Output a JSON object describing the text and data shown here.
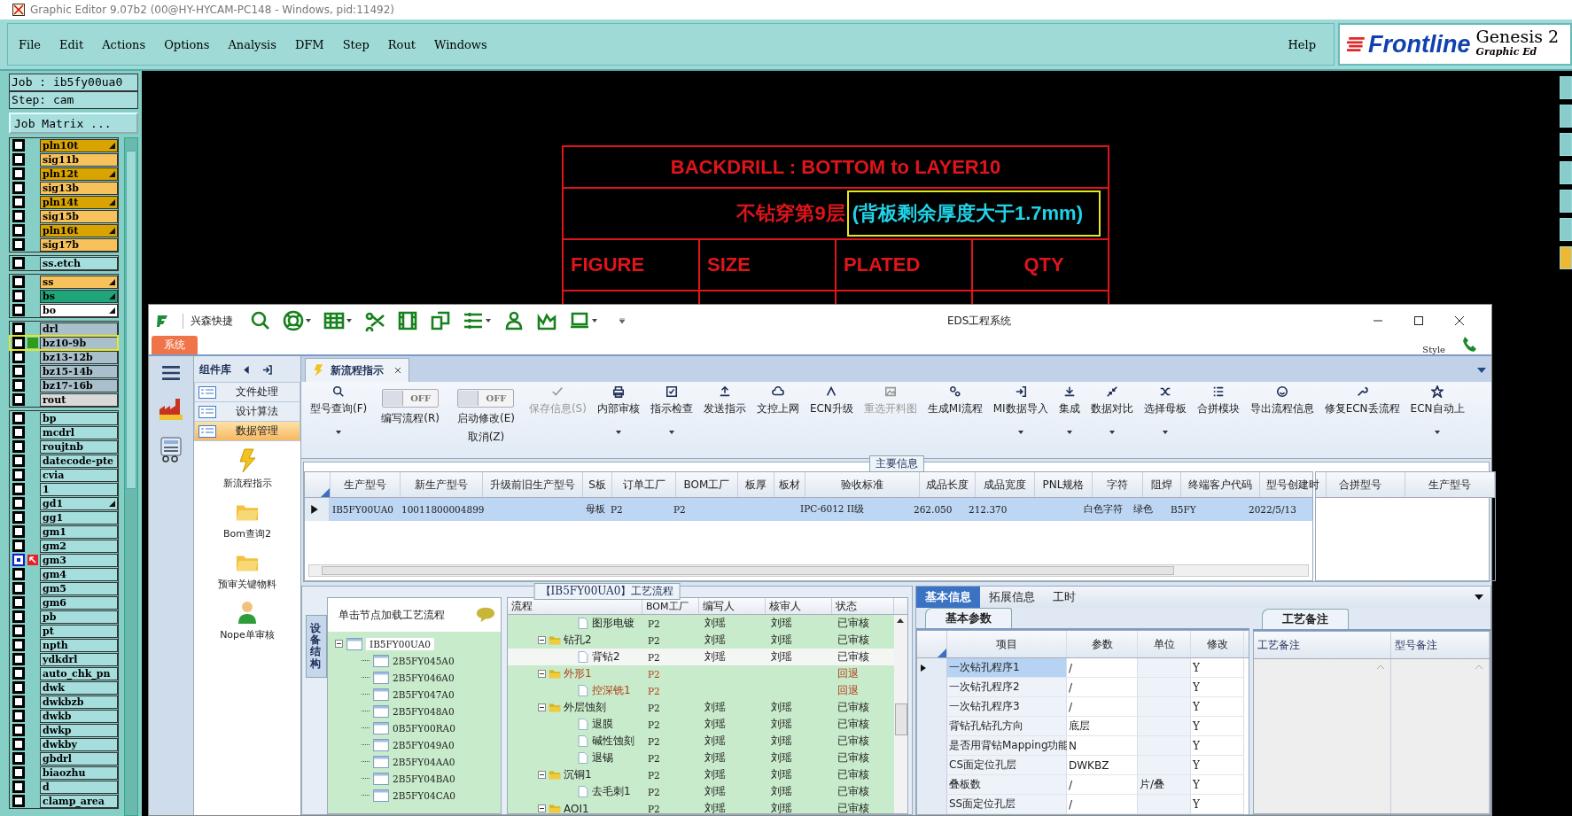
{
  "app_title": "Graphic Editor 9.07b2 (00@HY-HYCAM-PC148 - Windows, pid:11492)",
  "menu": [
    "File",
    "Edit",
    "Actions",
    "Options",
    "Analysis",
    "DFM",
    "Step",
    "Rout",
    "Windows"
  ],
  "help": "Help",
  "brand": {
    "name": "Frontline",
    "product": "Genesis 2",
    "subtitle": "Graphic Ed"
  },
  "job": {
    "job_line": "Job : ib5fy00ua0",
    "step_line": "Step: cam",
    "matrix_button": "Job Matrix ..."
  },
  "layer_groups": [
    {
      "layers": [
        {
          "name": "pln10t",
          "color": "#d9a300",
          "marked": true,
          "checked": false,
          "selected": false
        },
        {
          "name": "sig11b",
          "color": "#f7c25c",
          "marked": false,
          "checked": false,
          "selected": false
        },
        {
          "name": "pln12t",
          "color": "#d9a300",
          "marked": true,
          "checked": false,
          "selected": false
        },
        {
          "name": "sig13b",
          "color": "#f7c25c",
          "marked": false,
          "checked": false,
          "selected": false
        },
        {
          "name": "pln14t",
          "color": "#d9a300",
          "marked": true,
          "checked": false,
          "selected": false
        },
        {
          "name": "sig15b",
          "color": "#f7c25c",
          "marked": false,
          "checked": false,
          "selected": false
        },
        {
          "name": "pln16t",
          "color": "#d9a300",
          "marked": true,
          "checked": false,
          "selected": false
        },
        {
          "name": "sig17b",
          "color": "#f7c25c",
          "marked": false,
          "checked": false,
          "selected": false
        }
      ]
    },
    {
      "layers": [
        {
          "name": "ss.etch",
          "color": "#a6dede",
          "marked": false,
          "checked": false,
          "selected": false
        }
      ]
    },
    {
      "layers": [
        {
          "name": "ss",
          "color": "#f7c25c",
          "marked": true,
          "checked": false,
          "selected": false
        },
        {
          "name": "bs",
          "color": "#1fa57a",
          "marked": true,
          "checked": false,
          "selected": false
        },
        {
          "name": "bo",
          "color": "#ffffff",
          "marked": true,
          "checked": false,
          "selected": false
        }
      ]
    },
    {
      "layers": [
        {
          "name": "drl",
          "color": "#a9c0cc",
          "marked": false,
          "checked": false,
          "selected": false
        },
        {
          "name": "bz10-9b",
          "color": "#a9c0cc",
          "marked": false,
          "checked": false,
          "selected": true
        },
        {
          "name": "bz13-12b",
          "color": "#a9c0cc",
          "marked": false,
          "checked": false,
          "selected": false
        },
        {
          "name": "bz15-14b",
          "color": "#a9c0cc",
          "marked": false,
          "checked": false,
          "selected": false
        },
        {
          "name": "bz17-16b",
          "color": "#a9c0cc",
          "marked": false,
          "checked": false,
          "selected": false
        },
        {
          "name": "rout",
          "color": "#d9d9d9",
          "marked": false,
          "checked": false,
          "selected": false
        }
      ]
    },
    {
      "layers": [
        {
          "name": "bp",
          "color": "#a6dede",
          "marked": false,
          "checked": false,
          "selected": false
        },
        {
          "name": "mcdrl",
          "color": "#a6dede",
          "marked": false,
          "checked": false,
          "selected": false
        },
        {
          "name": "roujtnb",
          "color": "#a6dede",
          "marked": false,
          "checked": false,
          "selected": false
        },
        {
          "name": "datecode-pte",
          "color": "#a6dede",
          "marked": false,
          "checked": false,
          "selected": false
        },
        {
          "name": "cvia",
          "color": "#a6dede",
          "marked": false,
          "checked": false,
          "selected": false
        },
        {
          "name": "1",
          "color": "#a6dede",
          "marked": false,
          "checked": false,
          "selected": false
        },
        {
          "name": "gd1",
          "color": "#a6dede",
          "marked": true,
          "checked": false,
          "selected": false
        },
        {
          "name": "gg1",
          "color": "#a6dede",
          "marked": false,
          "checked": false,
          "selected": false
        },
        {
          "name": "gm1",
          "color": "#a6dede",
          "marked": false,
          "checked": false,
          "selected": false
        },
        {
          "name": "gm2",
          "color": "#a6dede",
          "marked": false,
          "checked": false,
          "selected": false
        },
        {
          "name": "gm3",
          "color": "#a6dede",
          "marked": false,
          "checked": true,
          "selected": false
        },
        {
          "name": "gm4",
          "color": "#a6dede",
          "marked": false,
          "checked": false,
          "selected": false
        },
        {
          "name": "gm5",
          "color": "#a6dede",
          "marked": false,
          "checked": false,
          "selected": false
        },
        {
          "name": "gm6",
          "color": "#a6dede",
          "marked": false,
          "checked": false,
          "selected": false
        },
        {
          "name": "pb",
          "color": "#a6dede",
          "marked": false,
          "checked": false,
          "selected": false
        },
        {
          "name": "pt",
          "color": "#a6dede",
          "marked": false,
          "checked": false,
          "selected": false
        },
        {
          "name": "npth",
          "color": "#a6dede",
          "marked": false,
          "checked": false,
          "selected": false
        },
        {
          "name": "ydkdrl",
          "color": "#a6dede",
          "marked": false,
          "checked": false,
          "selected": false
        },
        {
          "name": "auto_chk_pn",
          "color": "#a6dede",
          "marked": false,
          "checked": false,
          "selected": false
        },
        {
          "name": "dwk",
          "color": "#a6dede",
          "marked": false,
          "checked": false,
          "selected": false
        },
        {
          "name": "dwkbzb",
          "color": "#a6dede",
          "marked": false,
          "checked": false,
          "selected": false
        },
        {
          "name": "dwkb",
          "color": "#a6dede",
          "marked": false,
          "checked": false,
          "selected": false
        },
        {
          "name": "dwkp",
          "color": "#a6dede",
          "marked": false,
          "checked": false,
          "selected": false
        },
        {
          "name": "dwkby",
          "color": "#a6dede",
          "marked": false,
          "checked": false,
          "selected": false
        },
        {
          "name": "gbdrl",
          "color": "#a6dede",
          "marked": false,
          "checked": false,
          "selected": false
        },
        {
          "name": "biaozhu",
          "color": "#a6dede",
          "marked": false,
          "checked": false,
          "selected": false
        },
        {
          "name": "d",
          "color": "#a6dede",
          "marked": false,
          "checked": false,
          "selected": false
        },
        {
          "name": "clamp_area",
          "color": "#a6dede",
          "marked": false,
          "checked": false,
          "selected": false
        }
      ]
    }
  ],
  "canvas": {
    "title": "BACKDRILL : BOTTOM to LAYER10",
    "note": "不钻穿第9层",
    "note_highlight": "(背板剩余厚度大于1.7mm)",
    "headers": [
      "FIGURE",
      "SIZE",
      "PLATED",
      "QTY"
    ]
  },
  "eds": {
    "brand": "兴森快捷",
    "title": "EDS工程系统",
    "system_tab": "系统",
    "style": "Style",
    "toolbar": [
      {
        "has_menu": false
      },
      {
        "has_menu": true
      },
      {
        "has_menu": true
      },
      {
        "has_menu": false
      },
      {
        "has_menu": false
      },
      {
        "has_menu": false
      },
      {
        "has_menu": true
      },
      {
        "has_menu": false
      },
      {
        "has_menu": false
      },
      {
        "has_menu": true
      }
    ],
    "panel_title": "组件库",
    "panel_items": [
      {
        "label": "文件处理",
        "selected": false
      },
      {
        "label": "设计算法",
        "selected": false
      },
      {
        "label": "数据管理",
        "selected": true
      }
    ],
    "shortcuts": [
      {
        "label": "新流程指示"
      },
      {
        "label": "Bom查询2"
      },
      {
        "label": "预审关键物料"
      },
      {
        "label": "Nope单审核"
      }
    ],
    "doc_tab": "新流程指示",
    "ribbon": [
      {
        "kind": "button",
        "label": "型号查询(F)",
        "has_menu": true,
        "disabled": false
      },
      {
        "kind": "toggle",
        "label": "编写流程(R)",
        "switch_text": "OFF",
        "on": false
      },
      {
        "kind": "toggle",
        "label": "启动修改(E)",
        "label2": "取消(Z)",
        "switch_text": "OFF",
        "on": false
      },
      {
        "kind": "button",
        "label": "保存信息(S)",
        "has_menu": false,
        "disabled": true
      },
      {
        "kind": "button",
        "label": "内部审核",
        "has_menu": true,
        "disabled": false
      },
      {
        "kind": "button",
        "label": "指示检查",
        "has_menu": true,
        "disabled": false
      },
      {
        "kind": "button",
        "label": "发送指示",
        "has_menu": false,
        "disabled": false
      },
      {
        "kind": "button",
        "label": "文控上网",
        "has_menu": false,
        "disabled": false
      },
      {
        "kind": "button",
        "label": "ECN升级",
        "has_menu": false,
        "disabled": false
      },
      {
        "kind": "button",
        "label": "重选开料图",
        "has_menu": false,
        "disabled": true
      },
      {
        "kind": "button",
        "label": "生成MI流程",
        "has_menu": false,
        "disabled": false
      },
      {
        "kind": "button",
        "label": "MI数据导入",
        "has_menu": true,
        "disabled": false
      },
      {
        "kind": "button",
        "label": "集成",
        "has_menu": true,
        "disabled": false
      },
      {
        "kind": "button",
        "label": "数据对比",
        "has_menu": true,
        "disabled": false
      },
      {
        "kind": "button",
        "label": "选择母板",
        "has_menu": true,
        "disabled": false
      },
      {
        "kind": "button",
        "label": "合拼模块",
        "has_menu": false,
        "disabled": false
      },
      {
        "kind": "button",
        "label": "导出流程信息",
        "has_menu": false,
        "disabled": false
      },
      {
        "kind": "button",
        "label": "修复ECN丢流程",
        "has_menu": false,
        "disabled": false
      },
      {
        "kind": "button",
        "label": "ECN自动上",
        "has_menu": true,
        "disabled": false
      }
    ],
    "main_info": {
      "title": "主要信息",
      "columns": [
        "生产型号",
        "新生产型号",
        "升级前旧生产型号",
        "S板",
        "订单工厂",
        "BOM工厂",
        "板厚",
        "板材",
        "验收标准",
        "成品长度",
        "成品宽度",
        "PNL规格",
        "字符",
        "阻焊",
        "终端客户代码",
        "型号创建时"
      ],
      "rows": [
        {
          "selected": true,
          "cells": [
            "IB5FY00UA0",
            "10011800004899",
            null,
            "母板",
            "P2",
            "P2",
            null,
            null,
            "IPC-6012 II级",
            "262.050",
            "212.370",
            null,
            "白色字符",
            "绿色",
            "B5FY",
            "2022/5/13"
          ]
        }
      ],
      "side_columns": [
        "合拼型号",
        "生产型号"
      ]
    },
    "process": {
      "title": "【IB5FY00UA0】工艺流程",
      "side_tab": "设备结构",
      "tree_hint": "单击节点加载工艺流程",
      "tree": [
        {
          "label": "IB5FY00UA0",
          "expanded": true,
          "children": [
            {
              "label": "2B5FY045A0"
            },
            {
              "label": "2B5FY046A0"
            },
            {
              "label": "2B5FY047A0"
            },
            {
              "label": "2B5FY048A0"
            },
            {
              "label": "0B5FY00RA0"
            },
            {
              "label": "2B5FY049A0"
            },
            {
              "label": "2B5FY04AA0"
            },
            {
              "label": "2B5FY04BA0"
            },
            {
              "label": "2B5FY04CA0"
            }
          ]
        }
      ],
      "columns": [
        "流程",
        "BOM工厂",
        "编写人",
        "核审人",
        "状态"
      ],
      "rows": [
        {
          "kind": "group",
          "children": [
            {
              "kind": "file",
              "name": "图形电镀",
              "bom": "P2",
              "writer": "刘瑶",
              "reviewer": "刘瑶",
              "status": "已审核",
              "returned": false,
              "selected": false
            }
          ]
        },
        {
          "kind": "folder",
          "name": "钻孔2",
          "bom": "P2",
          "writer": "刘瑶",
          "reviewer": "刘瑶",
          "status": "已审核",
          "returned": false,
          "selected": false,
          "expanded": true,
          "children": [
            {
              "kind": "file",
              "name": "背钻2",
              "bom": "P2",
              "writer": "刘瑶",
              "reviewer": "刘瑶",
              "status": "已审核",
              "returned": false,
              "selected": true
            }
          ]
        },
        {
          "kind": "folder",
          "name": "外形1",
          "bom": "P2",
          "status": "回退",
          "returned": true,
          "selected": false,
          "expanded": true,
          "children": [
            {
              "kind": "file",
              "name": "控深铣1",
              "bom": "P2",
              "status": "回退",
              "returned": true,
              "selected": false
            }
          ]
        },
        {
          "kind": "folder",
          "name": "外层蚀刻",
          "bom": "P2",
          "writer": "刘瑶",
          "reviewer": "刘瑶",
          "status": "已审核",
          "returned": false,
          "selected": false,
          "expanded": true,
          "children": [
            {
              "kind": "file",
              "name": "退膜",
              "bom": "P2",
              "writer": "刘瑶",
              "reviewer": "刘瑶",
              "status": "已审核",
              "returned": false,
              "selected": false
            },
            {
              "kind": "file",
              "name": "碱性蚀刻",
              "bom": "P2",
              "writer": "刘瑶",
              "reviewer": "刘瑶",
              "status": "已审核",
              "returned": false,
              "selected": false
            },
            {
              "kind": "file",
              "name": "退锡",
              "bom": "P2",
              "writer": "刘瑶",
              "reviewer": "刘瑶",
              "status": "已审核",
              "returned": false,
              "selected": false
            }
          ]
        },
        {
          "kind": "folder",
          "name": "沉铜1",
          "bom": "P2",
          "writer": "刘瑶",
          "reviewer": "刘瑶",
          "status": "已审核",
          "returned": false,
          "selected": false,
          "expanded": true,
          "children": [
            {
              "kind": "file",
              "name": "去毛刺1",
              "bom": "P2",
              "writer": "刘瑶",
              "reviewer": "刘瑶",
              "status": "已审核",
              "returned": false,
              "selected": false
            }
          ]
        },
        {
          "kind": "folder",
          "name": "AOI1",
          "bom": "P2",
          "writer": "刘瑶",
          "reviewer": "刘瑶",
          "status": "已审核",
          "returned": false,
          "selected": false,
          "expanded": true
        }
      ]
    },
    "details": {
      "tabs": [
        {
          "label": "基本信息",
          "selected": true
        },
        {
          "label": "拓展信息",
          "selected": false
        },
        {
          "label": "工时",
          "selected": false
        }
      ],
      "params_tab": "基本参数",
      "columns": [
        "项目",
        "参数",
        "单位",
        "修改"
      ],
      "rows": [
        {
          "item": "一次钻孔程序1",
          "value": "/",
          "modified": "Y",
          "selected": true
        },
        {
          "item": "一次钻孔程序2",
          "value": "/",
          "modified": "Y",
          "selected": false
        },
        {
          "item": "一次钻孔程序3",
          "value": "/",
          "modified": "Y",
          "selected": false
        },
        {
          "item": "背钻孔钻孔方向",
          "value": "底层",
          "modified": "Y",
          "selected": false
        },
        {
          "item": "是否用背钻Mapping功能",
          "value": "N",
          "modified": "Y",
          "selected": false
        },
        {
          "item": "CS面定位孔层",
          "value": "DWKBZ",
          "modified": "Y",
          "selected": false
        },
        {
          "item": "叠板数",
          "value": "/",
          "unit": "片/叠",
          "modified": "Y",
          "selected": false
        },
        {
          "item": "SS面定位孔层",
          "value": "/",
          "modified": "Y",
          "selected": false
        }
      ],
      "notes_tab": "工艺备注",
      "notes_columns": [
        "工艺备注",
        "型号备注"
      ]
    }
  }
}
